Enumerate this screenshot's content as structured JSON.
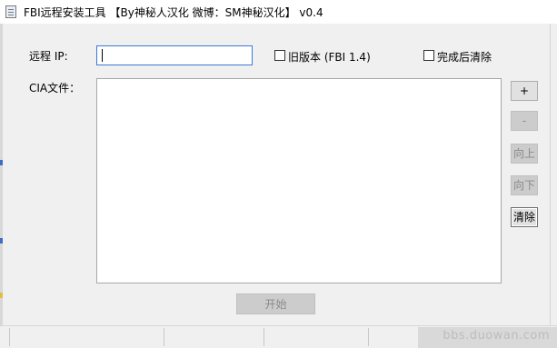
{
  "window": {
    "title": "FBI远程安装工具 【By神秘人汉化 微博：SM神秘汉化】 v0.4"
  },
  "form": {
    "ip_label": "远程 IP:",
    "ip_value": "",
    "old_version_label": "旧版本 (FBI 1.4)",
    "old_version_checked": false,
    "clear_after_label": "完成后清除",
    "clear_after_checked": false,
    "cia_label": "CIA文件：",
    "cia_files": []
  },
  "buttons": {
    "add": "+",
    "remove": "-",
    "move_up": "向上",
    "move_down": "向下",
    "clear": "清除",
    "start": "开始"
  },
  "watermark": "bbs.duowan.com"
}
